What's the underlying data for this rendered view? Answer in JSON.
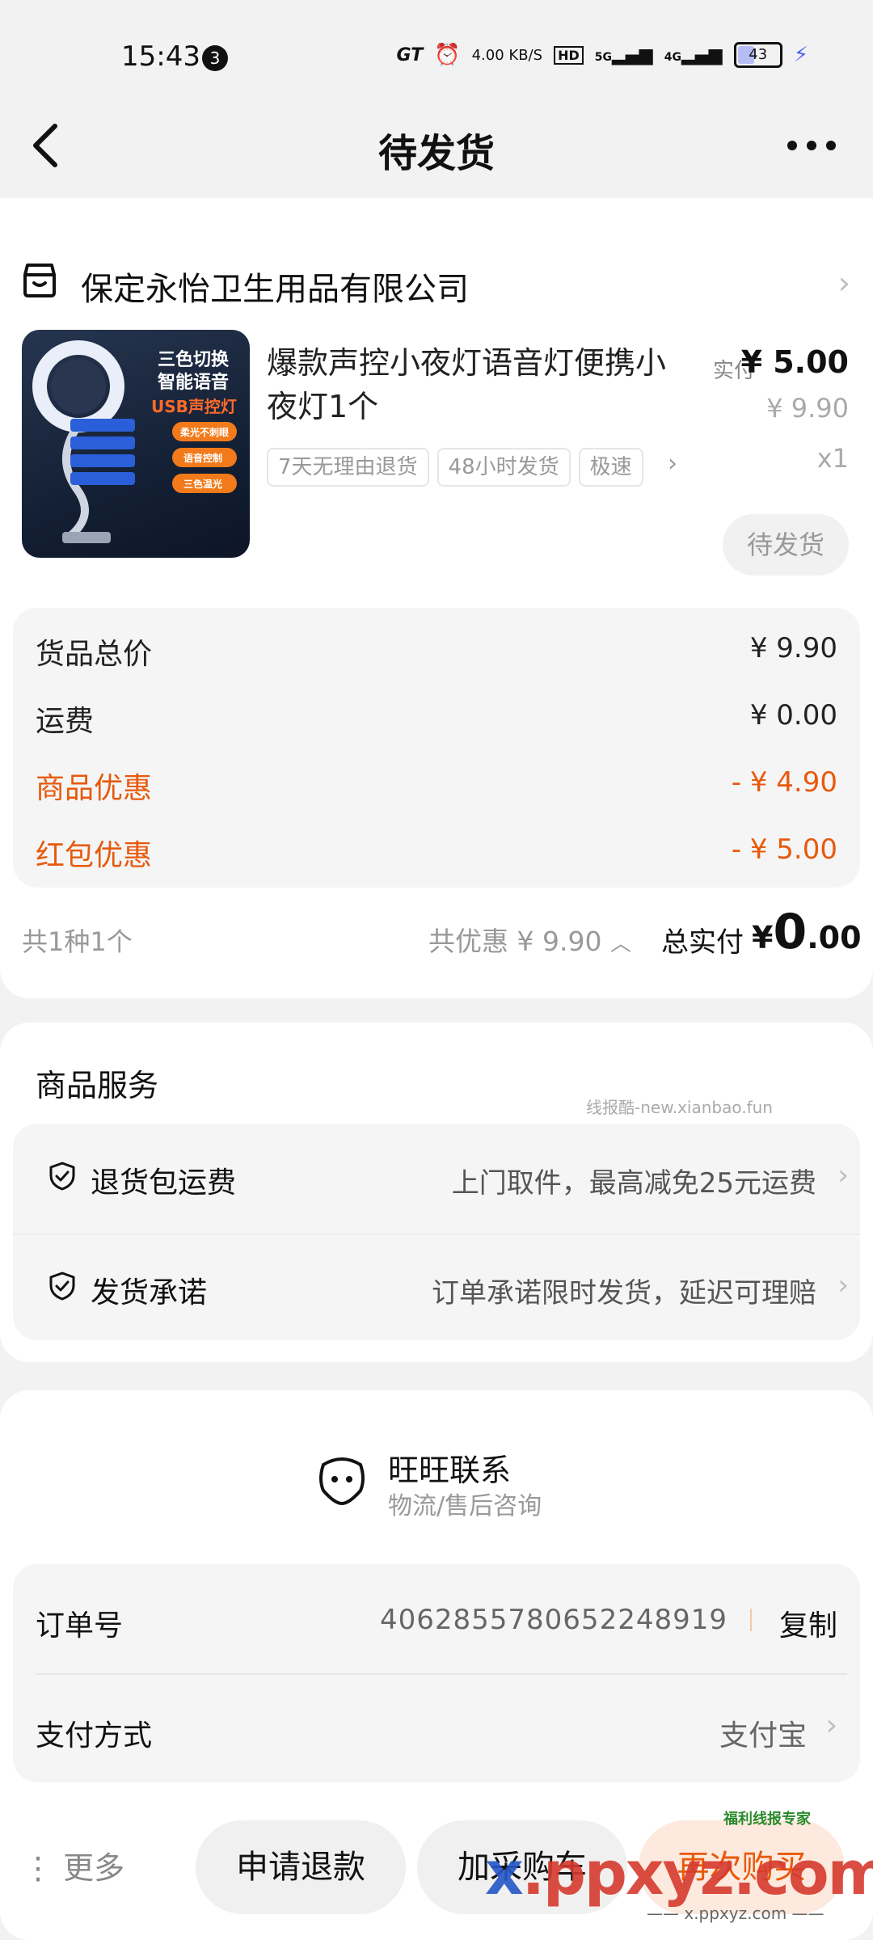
{
  "status_bar": {
    "time": "15:43",
    "notification_count": "3",
    "network_speed": "4.00 KB/S",
    "signal_5g": "5G",
    "signal_4g": "4G",
    "battery": "43",
    "gt_label": "GT",
    "hd_label": "HD"
  },
  "nav": {
    "title": "待发货"
  },
  "shop": {
    "name": "保定永怡卫生用品有限公司"
  },
  "product": {
    "title": "爆款声控小夜灯语音灯便携小夜灯1个",
    "paid_label": "实付",
    "paid_value": "¥ 5.00",
    "original_price": "¥ 9.90",
    "quantity": "x1",
    "tags": [
      "7天无理由退货",
      "48小时发货",
      "极速"
    ],
    "status_button": "待发货",
    "image_texts": [
      "三色切换",
      "智能语音",
      "USB声控灯",
      "柔光不刺眼",
      "语音控制",
      "三色温光"
    ]
  },
  "price_breakdown": {
    "rows": [
      {
        "label": "货品总价",
        "value": "¥ 9.90"
      },
      {
        "label": "运费",
        "value": "¥ 0.00"
      },
      {
        "label": "商品优惠",
        "value": "- ¥ 4.90"
      },
      {
        "label": "红包优惠",
        "value": "- ¥ 5.00"
      }
    ]
  },
  "summary": {
    "count": "共1种1个",
    "total_saving": "共优惠 ¥ 9.90",
    "total_label": "总实付",
    "total_currency": "¥",
    "total_int": "0",
    "total_dec": ".00"
  },
  "services": {
    "title": "商品服务",
    "watermark": "线报酷-new.xianbao.fun",
    "items": [
      {
        "label": "退货包运费",
        "desc": "上门取件，最高减免25元运费"
      },
      {
        "label": "发货承诺",
        "desc": "订单承诺限时发货，延迟可理赔"
      }
    ]
  },
  "wangwang": {
    "title": "旺旺联系",
    "subtitle": "物流/售后咨询"
  },
  "order_info": {
    "order_label": "订单号",
    "order_number": "4062855780652248919",
    "copy_label": "复制",
    "pay_label": "支付方式",
    "pay_value": "支付宝"
  },
  "bottom_bar": {
    "more": "更多",
    "refund": "申请退款",
    "add_cart": "加采购车",
    "rebuy": "再次购买"
  },
  "site_watermark": {
    "main_x": "x",
    "main_rest": ".ppxyz.com",
    "sub": "—— x.ppxyz.com ——",
    "badge": "福利线报专家"
  },
  "colors": {
    "accent_orange": "#e8590c",
    "background": "#f2f2f2",
    "card": "#ffffff"
  }
}
